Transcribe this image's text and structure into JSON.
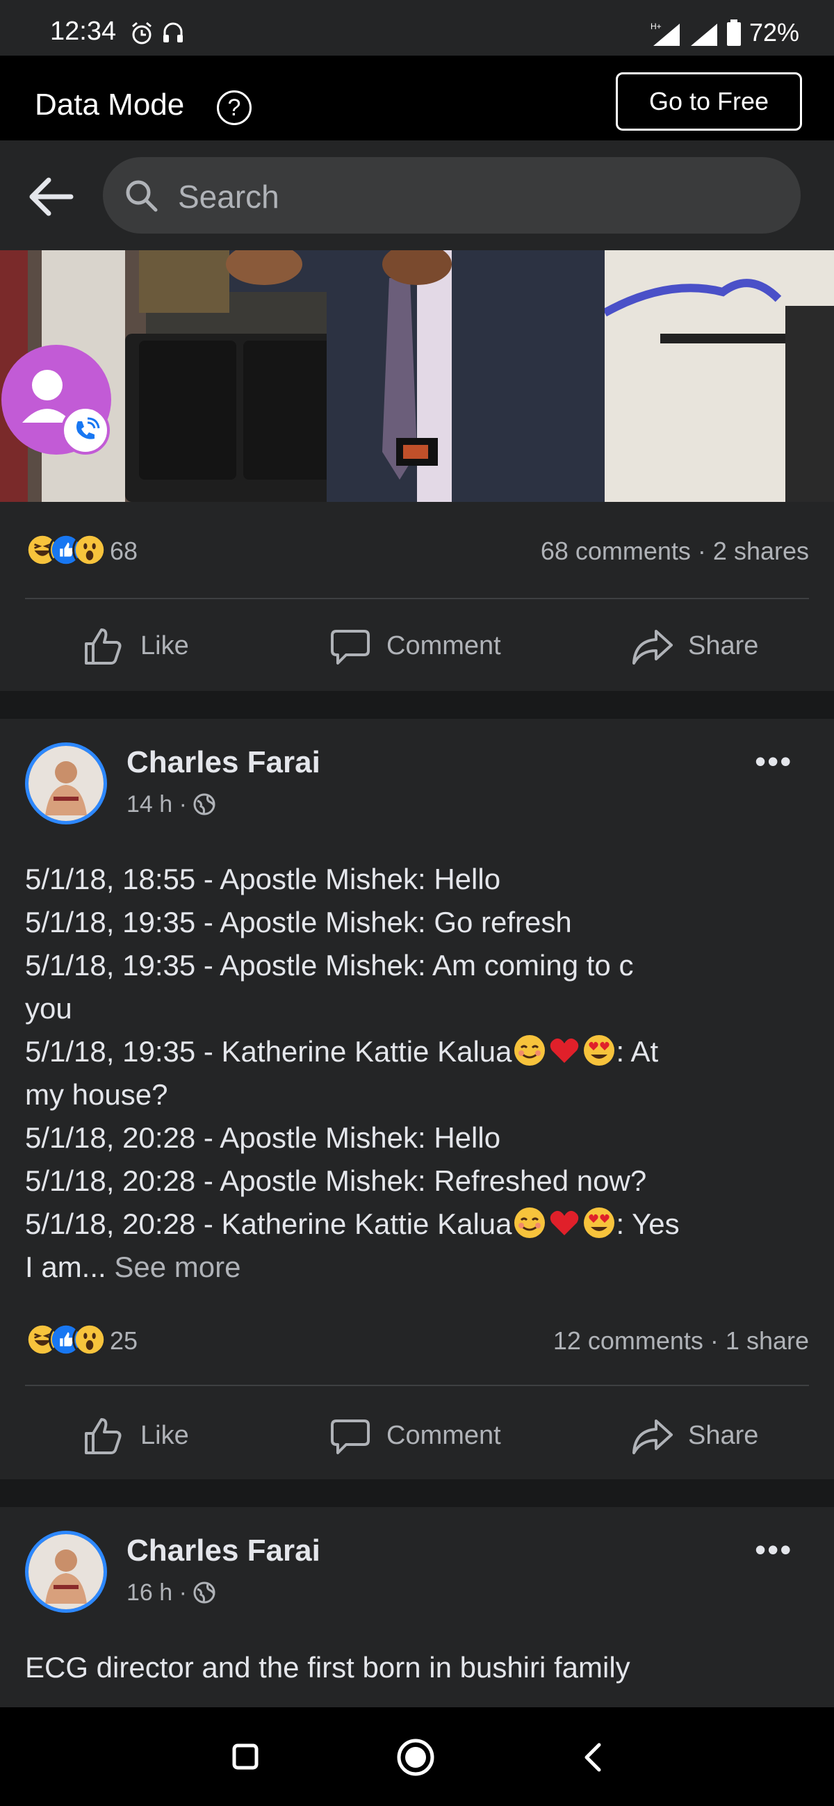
{
  "status_bar": {
    "time": "12:34",
    "battery": "72%"
  },
  "data_mode_bar": {
    "label": "Data Mode",
    "help": "?",
    "go_free": "Go to Free"
  },
  "search": {
    "placeholder": "Search"
  },
  "post1": {
    "reactions_count": "68",
    "comments_shares": "68 comments · 2 shares",
    "actions": {
      "like": "Like",
      "comment": "Comment",
      "share": "Share"
    }
  },
  "post2": {
    "author": "Charles Farai",
    "time": "14 h ·",
    "lines": [
      "5/1/18, 18:55 - Apostle Mishek: Hello",
      "5/1/18, 19:35 - Apostle Mishek: Go refresh",
      "5/1/18, 19:35 - Apostle Mishek: Am coming to c",
      "you",
      "5/1/18, 19:35 - Katherine Kattie Kalua",
      ": At",
      "my house?",
      "5/1/18, 20:28 - Apostle Mishek: Hello",
      "5/1/18, 20:28 - Apostle Mishek: Refreshed now?",
      "5/1/18, 20:28 - Katherine Kattie Kalua",
      ": Yes",
      "I am... ",
      "See more"
    ],
    "reactions_count": "25",
    "comments_shares": "12 comments · 1 share",
    "actions": {
      "like": "Like",
      "comment": "Comment",
      "share": "Share"
    }
  },
  "post3": {
    "author": "Charles Farai",
    "time": "16 h ·",
    "text": "ECG director and the first born in bushiri family"
  }
}
